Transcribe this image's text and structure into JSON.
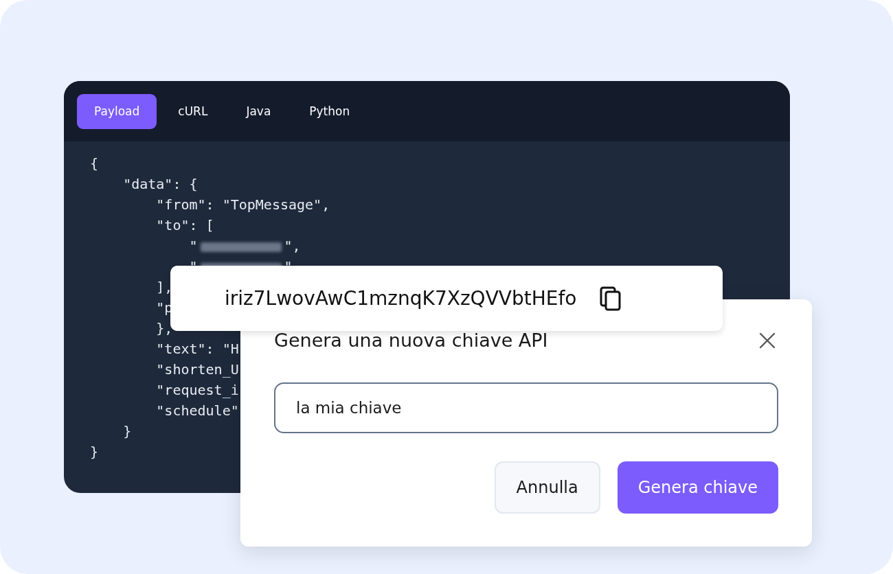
{
  "editor": {
    "tabs": [
      {
        "label": "Payload",
        "selected": true
      },
      {
        "label": "cURL",
        "selected": false
      },
      {
        "label": "Java",
        "selected": false
      },
      {
        "label": "Python",
        "selected": false
      }
    ],
    "code_lines": [
      {
        "text": "{"
      },
      {
        "text": "    \"data\": {"
      },
      {
        "text": "        \"from\": \"TopMessage\","
      },
      {
        "text": "        \"to\": ["
      },
      {
        "text": "            \"",
        "blurred": true,
        "text_after": "\","
      },
      {
        "text": "            \"",
        "blurred": true,
        "text_after": "\""
      },
      {
        "text": "        ],"
      },
      {
        "text": "        \"p"
      },
      {
        "text": "        },"
      },
      {
        "text": "        \"text\": \"H"
      },
      {
        "text": "        \"shorten_U"
      },
      {
        "text": "        \"request_i"
      },
      {
        "text": "        \"schedule\""
      },
      {
        "text": "    }"
      },
      {
        "text": "}"
      }
    ]
  },
  "api_key": {
    "value": "iriz7LwovAwC1mznqK7XzQVVbtHEfo"
  },
  "dialog": {
    "title": "Genera una nuova chiave API",
    "name_field": {
      "value": "la mia chiave"
    },
    "buttons": [
      {
        "label": "Annulla",
        "kind": "secondary"
      },
      {
        "label": "Genera chiave",
        "kind": "primary"
      }
    ]
  }
}
